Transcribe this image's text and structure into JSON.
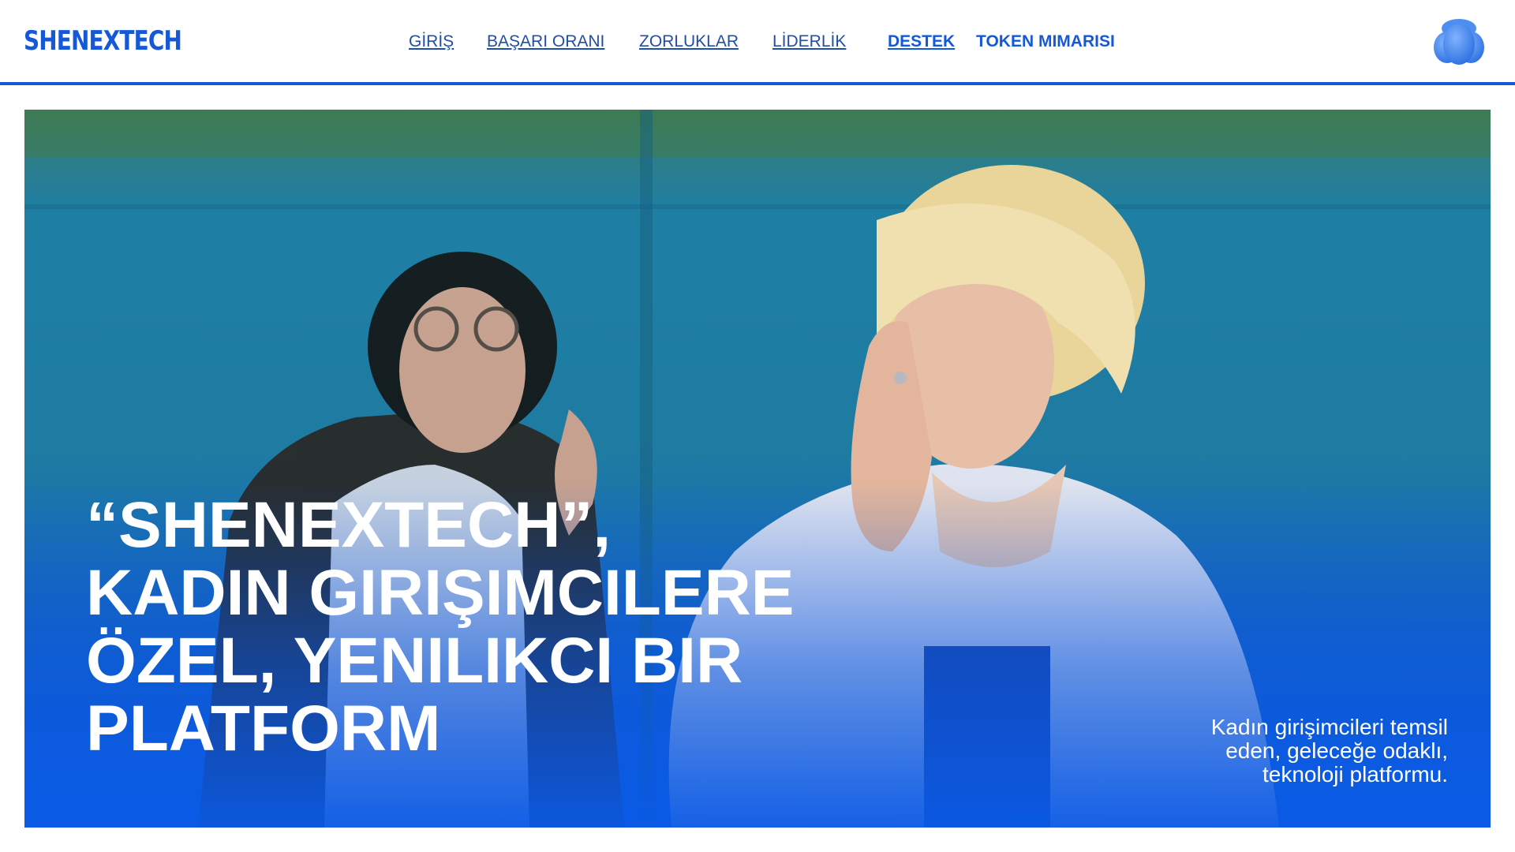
{
  "brand": {
    "logo_text": "SHENEXTECH",
    "accent_color": "#1559d6"
  },
  "nav": {
    "items": [
      {
        "label": "GİRİŞ"
      },
      {
        "label": "BAŞARI ORANI"
      },
      {
        "label": "ZORLUKLAR"
      },
      {
        "label": "LİDERLİK"
      },
      {
        "label": "DESTEK"
      },
      {
        "label": "TOKEN MIMARISI"
      }
    ]
  },
  "header": {
    "avatar_icon": "user-avatar-icon"
  },
  "hero": {
    "headline_lines": [
      "“SHENEXTECH”,",
      "KADIN GIRIŞIMCILERE",
      "ÖZEL, YENILIKCI BIR",
      "PLATFORM"
    ],
    "tagline_lines": [
      "Kadın girişimcileri temsil",
      "eden, geleceğe odaklı,",
      "teknoloji platformu."
    ]
  }
}
